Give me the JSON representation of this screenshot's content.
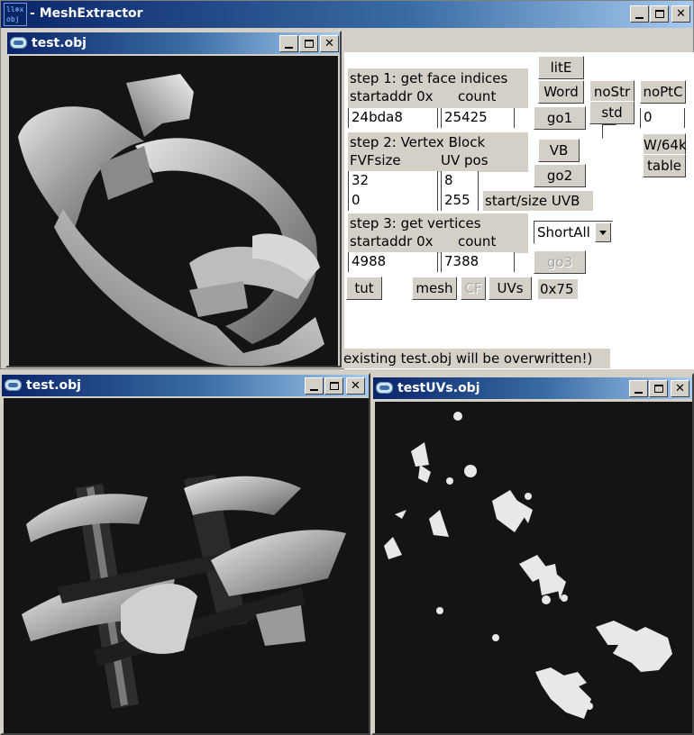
{
  "app": {
    "title": "MeshExtractor",
    "title_prefix": "- ",
    "icon_line1": "ll⊗x",
    "icon_line2": "obj"
  },
  "windows": {
    "top_model": {
      "title": "test.obj"
    },
    "bottom_model": {
      "title": "test.obj"
    },
    "uv_view": {
      "title": "testUVs.obj"
    }
  },
  "panel": {
    "step1": {
      "title": "step 1: get face indices",
      "addr_label": "startaddr 0x",
      "count_label": "count",
      "addr_value": "24bda8",
      "count_value": "25425"
    },
    "step2": {
      "title": "step 2: Vertex Block",
      "fvf_label": "FVFsize",
      "uvpos_label": "UV pos",
      "fvf_value": "32",
      "uvpos_value": "8",
      "uvb_start_value": "0",
      "uvb_size_value": "255",
      "uvb_label": "start/size UVB"
    },
    "step3": {
      "title": "step 3: get vertices",
      "addr_label": "startaddr 0x",
      "count_label": "count",
      "addr_value": "4988",
      "count_value": "7388"
    },
    "buttons": {
      "lite": "litE",
      "word": "Word",
      "nostr": "noStr",
      "noptc": "noPtC",
      "go1": "go1",
      "std": "std",
      "vb": "VB",
      "go2": "go2",
      "w64k": "W/64k",
      "table": "table",
      "go3": "go3",
      "tut": "tut",
      "mesh": "mesh",
      "cf": "CF",
      "uvs": "UVs"
    },
    "noptc_value": "0",
    "format_select": "ShortAll",
    "hex_readout": "0x75",
    "status": "existing test.obj will be overwritten!)"
  }
}
